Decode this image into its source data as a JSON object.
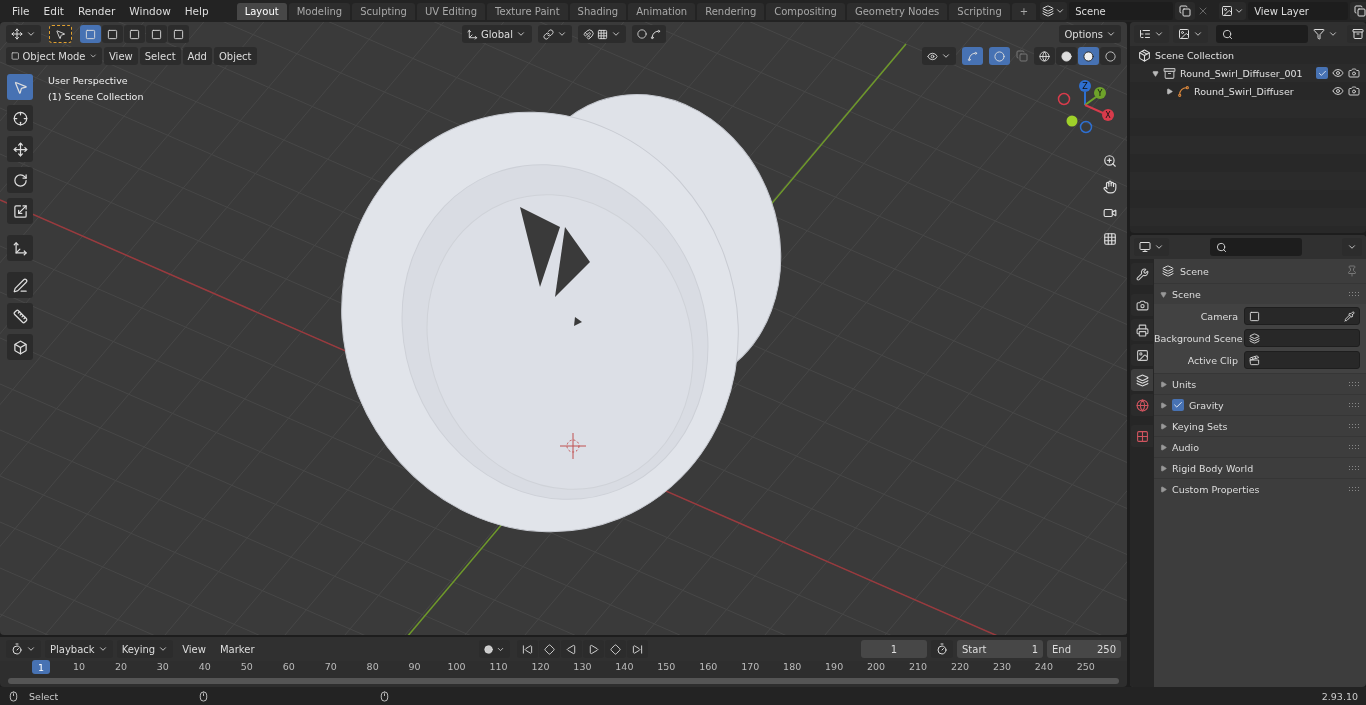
{
  "menu": [
    "File",
    "Edit",
    "Render",
    "Window",
    "Help"
  ],
  "workspaces": [
    {
      "label": "Layout",
      "selected": true
    },
    {
      "label": "Modeling",
      "selected": false
    },
    {
      "label": "Sculpting",
      "selected": false
    },
    {
      "label": "UV Editing",
      "selected": false
    },
    {
      "label": "Texture Paint",
      "selected": false
    },
    {
      "label": "Shading",
      "selected": false
    },
    {
      "label": "Animation",
      "selected": false
    },
    {
      "label": "Rendering",
      "selected": false
    },
    {
      "label": "Compositing",
      "selected": false
    },
    {
      "label": "Geometry Nodes",
      "selected": false
    },
    {
      "label": "Scripting",
      "selected": false
    }
  ],
  "add_workspace": "+",
  "scene_field": {
    "value": "Scene"
  },
  "view_layer_field": {
    "value": "View Layer"
  },
  "viewport": {
    "select_modes": [
      {
        "selected": true
      },
      {
        "selected": false
      },
      {
        "selected": false
      },
      {
        "selected": false
      },
      {
        "selected": false
      }
    ],
    "transform_orientation": "Global",
    "options": "Options",
    "mode": "Object Mode",
    "menus": [
      "View",
      "Select",
      "Add",
      "Object"
    ],
    "shading_modes": [
      {
        "kind": "wireframe",
        "selected": false
      },
      {
        "kind": "solid",
        "selected": false
      },
      {
        "kind": "material",
        "selected": true
      },
      {
        "kind": "rendered",
        "selected": false
      }
    ],
    "overlay_text": [
      "User Perspective",
      "(1) Scene Collection"
    ],
    "tools": [
      {
        "kind": "select",
        "selected": true
      },
      {
        "kind": "cursor",
        "selected": false
      },
      {
        "kind": "move",
        "selected": false
      },
      {
        "kind": "rotate",
        "selected": false
      },
      {
        "kind": "scale",
        "selected": false
      },
      {
        "kind": "transform",
        "selected": false
      },
      {
        "kind": "annotate",
        "selected": false
      },
      {
        "kind": "measure",
        "selected": false
      },
      {
        "kind": "add-cube",
        "selected": false
      }
    ],
    "gizmo_axes": [
      "Z",
      "Y",
      "X"
    ]
  },
  "outliner": {
    "items": [
      {
        "label": "Scene Collection",
        "kind": "scene",
        "children": [
          {
            "label": "Round_Swirl_Diffuser_001",
            "kind": "collection",
            "expanded": true,
            "checked": true,
            "children": [
              {
                "label": "Round_Swirl_Diffuser",
                "kind": "object",
                "expanded": false
              }
            ]
          }
        ]
      }
    ]
  },
  "properties": {
    "tabs": [
      {
        "kind": "tool",
        "selected": false
      },
      {
        "kind": "render",
        "selected": false
      },
      {
        "kind": "output",
        "selected": false
      },
      {
        "kind": "view-layer",
        "selected": false
      },
      {
        "kind": "scene",
        "selected": true
      },
      {
        "kind": "world",
        "selected": false
      },
      {
        "kind": "texture",
        "selected": false
      }
    ],
    "context": "Scene",
    "panel": {
      "title": "Scene",
      "expanded": true,
      "fields": [
        {
          "label": "Camera",
          "kind": "camera"
        },
        {
          "label": "Background Scene",
          "kind": "scene"
        },
        {
          "label": "Active Clip",
          "kind": "clip"
        }
      ]
    },
    "subpanels": [
      {
        "label": "Units",
        "kind": "plain",
        "expanded": false
      },
      {
        "label": "Gravity",
        "kind": "checkbox",
        "checked": true,
        "expanded": false
      },
      {
        "label": "Keying Sets",
        "kind": "plain",
        "expanded": false
      },
      {
        "label": "Audio",
        "kind": "plain",
        "expanded": false
      },
      {
        "label": "Rigid Body World",
        "kind": "plain",
        "expanded": false
      },
      {
        "label": "Custom Properties",
        "kind": "plain",
        "expanded": false
      }
    ]
  },
  "timeline": {
    "menus": [
      "Playback",
      "Keying",
      "View",
      "Marker"
    ],
    "current_frame": "1",
    "start_label": "Start",
    "start": "1",
    "end_label": "End",
    "end": "250",
    "marker": "1",
    "ticks": [
      "10",
      "20",
      "30",
      "40",
      "50",
      "60",
      "70",
      "80",
      "90",
      "100",
      "110",
      "120",
      "130",
      "140",
      "150",
      "160",
      "170",
      "180",
      "190",
      "200",
      "210",
      "220",
      "230",
      "240",
      "250"
    ]
  },
  "status": {
    "action": "Select",
    "version": "2.93.10"
  }
}
